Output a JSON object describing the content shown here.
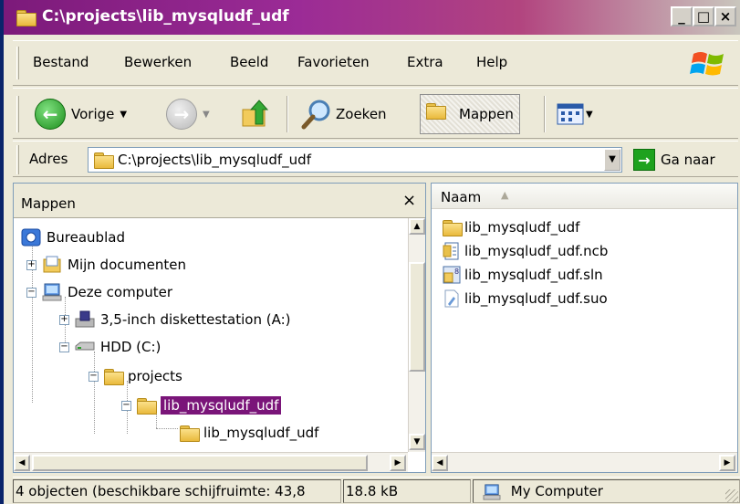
{
  "window": {
    "title": "C:\\projects\\lib_mysqludf_udf",
    "buttons": {
      "minimize": "_",
      "maximize": "□",
      "close": "×"
    }
  },
  "menu": {
    "items": [
      "Bestand",
      "Bewerken",
      "Beeld",
      "Favorieten",
      "Extra",
      "Help"
    ]
  },
  "toolbar": {
    "back_label": "Vorige",
    "search_label": "Zoeken",
    "folders_label": "Mappen"
  },
  "address": {
    "label": "Adres",
    "value": "C:\\projects\\lib_mysqludf_udf",
    "go_label": "Ga naar"
  },
  "folders_pane": {
    "title": "Mappen",
    "close": "×",
    "tree": [
      {
        "label": "Bureaublad",
        "icon": "desktop-icon"
      },
      {
        "label": "Mijn documenten",
        "icon": "my-documents-icon",
        "expander": "+"
      },
      {
        "label": "Deze computer",
        "icon": "my-computer-icon",
        "expander": "−"
      },
      {
        "label": "3,5-inch diskettestation (A:)",
        "icon": "floppy-drive-icon",
        "expander": "+"
      },
      {
        "label": "HDD (C:)",
        "icon": "hard-drive-icon",
        "expander": "−"
      },
      {
        "label": "projects",
        "icon": "folder-icon",
        "expander": "−"
      },
      {
        "label": "lib_mysqludf_udf",
        "icon": "open-folder-icon",
        "expander": "−",
        "selected": true
      },
      {
        "label": "lib_mysqludf_udf",
        "icon": "folder-icon"
      }
    ]
  },
  "files_pane": {
    "column_name": "Naam",
    "files": [
      {
        "name": "lib_mysqludf_udf",
        "icon": "folder-icon"
      },
      {
        "name": "lib_mysqludf_udf.ncb",
        "icon": "ncb-file-icon"
      },
      {
        "name": "lib_mysqludf_udf.sln",
        "icon": "sln-file-icon"
      },
      {
        "name": "lib_mysqludf_udf.suo",
        "icon": "suo-file-icon"
      }
    ]
  },
  "status": {
    "objects": "4 objecten (beschikbare schijfruimte: 43,8",
    "size": "18.8 kB",
    "location": "My Computer"
  }
}
